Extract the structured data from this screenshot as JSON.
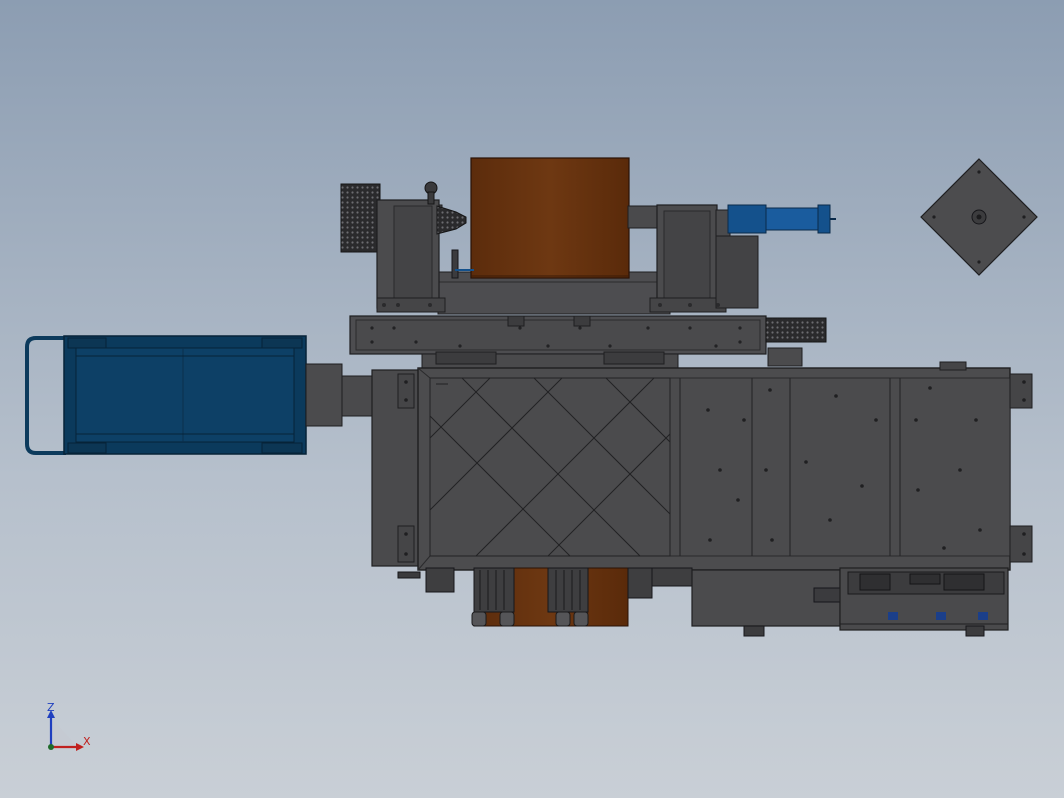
{
  "view": {
    "colors": {
      "background_top": "#8c9db2",
      "background_bottom": "#c9cfd6",
      "machine_body": "#4b4b4d",
      "machine_edge": "#1e1e20",
      "machine_dark": "#39393b",
      "copper_roll": "#6a3410",
      "cart_blue": "#0c3a5c",
      "actuator_blue": "#14518c",
      "axis_z": "#1f3fbf",
      "axis_x": "#c0201e",
      "axis_origin": "#1e6a2a"
    }
  },
  "triad": {
    "z_label": "Z",
    "x_label": "X"
  }
}
